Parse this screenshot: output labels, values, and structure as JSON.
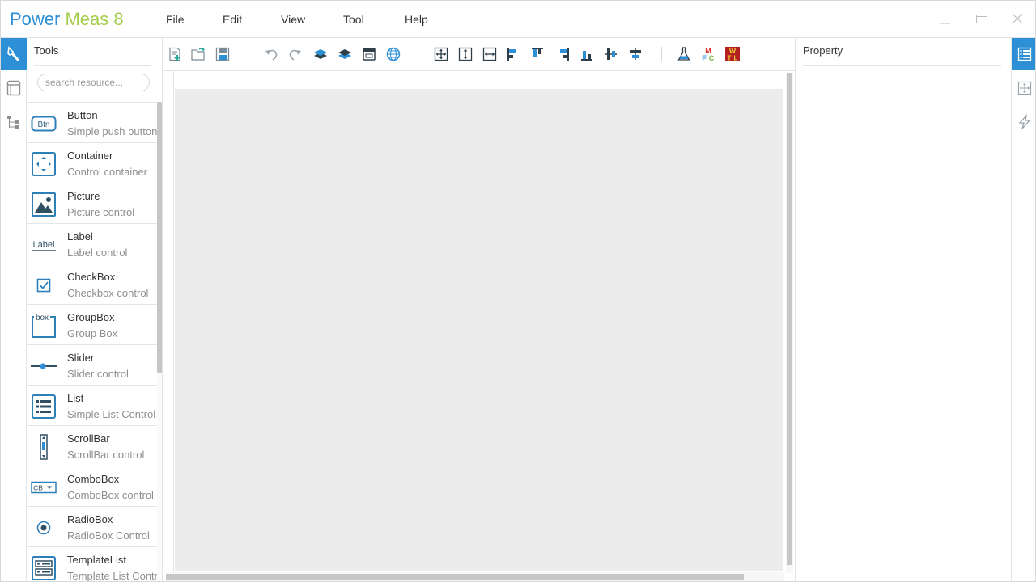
{
  "app": {
    "title_part1": "Power",
    "title_part2": "Meas 8",
    "menu": [
      "File",
      "Edit",
      "View",
      "Tool",
      "Help"
    ]
  },
  "window_controls": {
    "minimize": "minimize-icon",
    "maximize": "maximize-icon",
    "close": "close-icon"
  },
  "left_rail": {
    "items": [
      "tools-icon",
      "database-icon",
      "tree-icon"
    ],
    "active": 0
  },
  "tools_panel": {
    "title": "Tools",
    "search_placeholder": "search resource...",
    "items": [
      {
        "name": "Button",
        "desc": "Simple push button",
        "icon": "button-icon"
      },
      {
        "name": "Container",
        "desc": "Control container",
        "icon": "container-icon"
      },
      {
        "name": "Picture",
        "desc": "Picture control",
        "icon": "picture-icon"
      },
      {
        "name": "Label",
        "desc": "Label control",
        "icon": "label-icon"
      },
      {
        "name": "CheckBox",
        "desc": "Checkbox control",
        "icon": "checkbox-icon"
      },
      {
        "name": "GroupBox",
        "desc": "Group Box",
        "icon": "groupbox-icon"
      },
      {
        "name": "Slider",
        "desc": "Slider control",
        "icon": "slider-icon"
      },
      {
        "name": "List",
        "desc": "Simple List Control",
        "icon": "list-icon"
      },
      {
        "name": "ScrollBar",
        "desc": "ScrollBar control",
        "icon": "scrollbar-icon"
      },
      {
        "name": "ComboBox",
        "desc": "ComboBox control",
        "icon": "combobox-icon"
      },
      {
        "name": "RadioBox",
        "desc": "RadioBox Control",
        "icon": "radiobox-icon"
      },
      {
        "name": "TemplateList",
        "desc": "Template List Control",
        "icon": "templatelist-icon"
      }
    ],
    "icon_text": {
      "button": "Btn",
      "label": "Label",
      "groupbox": "box",
      "combobox": "CB"
    }
  },
  "toolbar": {
    "icons": [
      "new-file-icon",
      "open-file-icon",
      "save-icon",
      "undo-icon",
      "redo-icon",
      "bring-to-front-icon",
      "send-to-back-icon",
      "window-icon",
      "globe-icon",
      "fit-all-icon",
      "fit-height-icon",
      "fit-width-icon",
      "align-left-icon",
      "align-top-icon",
      "align-right-icon",
      "align-bottom-icon",
      "align-center-vertical-icon",
      "align-center-horizontal-icon",
      "flask-icon",
      "mfc-icon",
      "wtl-icon"
    ],
    "mfc_text": {
      "m": "M",
      "f": "F",
      "c": "C"
    },
    "wtl_text": {
      "w": "W",
      "t": "T",
      "l": "L"
    }
  },
  "property_panel": {
    "title": "Property"
  },
  "right_rail": {
    "items": [
      "property-list-icon",
      "layout-icon",
      "events-icon"
    ],
    "active": 0
  },
  "colors": {
    "accent": "#2d8fd6",
    "brand_green": "#a3cc4a",
    "surface": "#ececec",
    "icon_dark": "#2f6f95"
  }
}
